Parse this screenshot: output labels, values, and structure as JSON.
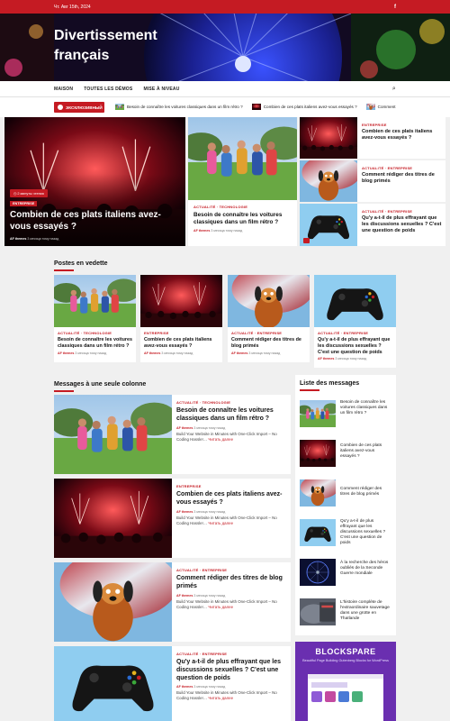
{
  "topbar": {
    "date": "Чт. Авг 15th, 2024",
    "social_icon": "facebook-icon"
  },
  "site": {
    "title_line1": "Divertissement",
    "title_line2": "français"
  },
  "nav": {
    "items": [
      "MAISON",
      "TOUTES LES DÉMOS",
      "MISE À NIVEAU"
    ],
    "search_icon": "search-icon"
  },
  "ticker": {
    "label": "ЭКСКЛЮЗИВНЫЙ",
    "items": [
      "Besoin de connaître les voitures classiques dans un film rétro ?",
      "Combien de ces plats italiens avez-vous essayés ?",
      "Comment"
    ]
  },
  "hero": {
    "main": {
      "badge": "2 минуты чтения",
      "category": "ENTREPRISE",
      "title": "Combien de ces plats italiens avez-vous essayés ?",
      "author": "AF themes",
      "time": "3 месяца тому назад"
    },
    "center": {
      "category": "ACTUALITÉ · TECHNOLOGIE",
      "title": "Besoin de connaître les voitures classiques dans un film rétro ?",
      "author": "AF themes",
      "time": "3 месяца тому назад"
    },
    "side": [
      {
        "category": "ENTREPRISE",
        "title": "Combien de ces plats italiens avez-vous essayés ?"
      },
      {
        "category": "ACTUALITÉ · ENTREPRISE",
        "title": "Comment rédiger des titres de blog primés"
      },
      {
        "category": "ACTUALITÉ · ENTREPRISE",
        "title": "Qu'y a-t-il de plus effrayant que les discussions sexuelles ? C'est une question de poids"
      }
    ]
  },
  "featured": {
    "heading": "Postes en vedette",
    "items": [
      {
        "category": "ACTUALITÉ · TECHNOLOGIE",
        "title": "Besoin de connaître les voitures classiques dans un film rétro ?",
        "author": "AF themes",
        "time": "3 месяца тому назад"
      },
      {
        "category": "ENTREPRISE",
        "title": "Combien de ces plats italiens avez-vous essayés ?",
        "author": "AF themes",
        "time": "3 месяца тому назад"
      },
      {
        "category": "ACTUALITÉ · ENTREPRISE",
        "title": "Comment rédiger des titres de blog primés",
        "author": "AF themes",
        "time": "3 месяца тому назад"
      },
      {
        "category": "ACTUALITÉ · ENTREPRISE",
        "title": "Qu'y a-t-il de plus effrayant que les discussions sexuelles ? C'est une question de poids",
        "author": "AF themes",
        "time": "3 месяца тому назад"
      }
    ]
  },
  "single": {
    "heading": "Messages à une seule colonne",
    "items": [
      {
        "category": "ACTUALITÉ · TECHNOLOGIE",
        "title": "Besoin de connaître les voitures classiques dans un film rétro ?",
        "author": "AF themes",
        "time": "3 месяца тому назад",
        "excerpt": "Build Your Website in Minutes with One-Click Import – No Coding Hassle!…",
        "more": "Читать далее"
      },
      {
        "category": "ENTREPRISE",
        "title": "Combien de ces plats italiens avez-vous essayés ?",
        "author": "AF themes",
        "time": "3 месяца тому назад",
        "excerpt": "Build Your Website in Minutes with One-Click Import – No Coding Hassle!…",
        "more": "Читать далее"
      },
      {
        "category": "ACTUALITÉ · ENTREPRISE",
        "title": "Comment rédiger des titres de blog primés",
        "author": "AF themes",
        "time": "3 месяца тому назад",
        "excerpt": "Build Your Website in Minutes with One-Click Import – No Coding Hassle!…",
        "more": "Читать далее"
      },
      {
        "category": "ACTUALITÉ · ENTREPRISE",
        "title": "Qu'y a-t-il de plus effrayant que les discussions sexuelles ? C'est une question de poids",
        "author": "AF themes",
        "time": "3 месяца тому назад",
        "excerpt": "Build Your Website in Minutes with One-Click Import – No Coding Hassle!…",
        "more": "Читать далее"
      }
    ]
  },
  "list": {
    "heading": "Liste des messages",
    "items": [
      "Besoin de connaître les voitures classiques dans un film rétro ?",
      "Combien de ces plats italiens avez-vous essayés ?",
      "Comment rédiger des titres de blog primés",
      "Qu'y a-t-il de plus effrayant que les discussions sexuelles ? C'est une question de poids",
      "À la recherche des héros oubliés de la Seconde Guerre mondiale",
      "L'histoire complète de l'extraordinaire sauvetage dans une grotte en Thaïlande"
    ]
  },
  "ad": {
    "brand": "BLOCKSPARE",
    "tagline": "Beautiful Page Building Gutenberg Blocks for WordPress"
  },
  "colors": {
    "accent": "#c51b23",
    "dark": "#111111"
  }
}
